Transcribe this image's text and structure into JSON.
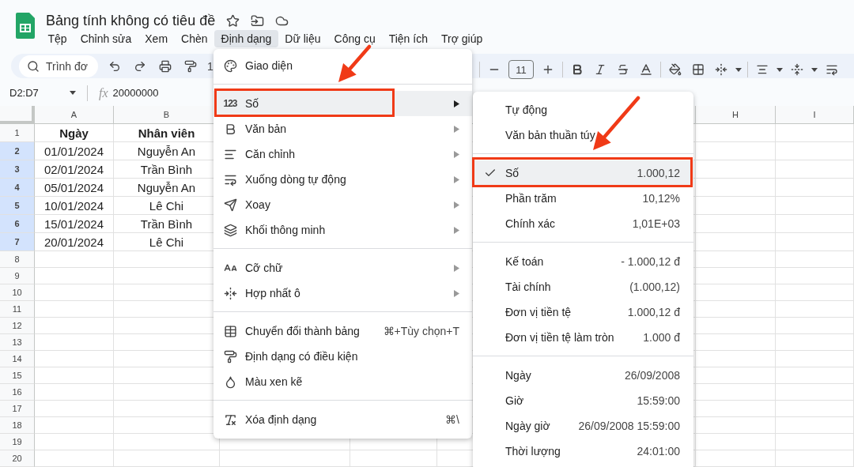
{
  "app": {
    "title": "Bảng tính không có tiêu đề",
    "menu": [
      {
        "label": "Tệp",
        "selected": false
      },
      {
        "label": "Chỉnh sửa",
        "selected": false
      },
      {
        "label": "Xem",
        "selected": false
      },
      {
        "label": "Chèn",
        "selected": false
      },
      {
        "label": "Định dạng",
        "selected": true
      },
      {
        "label": "Dữ liệu",
        "selected": false
      },
      {
        "label": "Công cụ",
        "selected": false
      },
      {
        "label": "Tiện ích",
        "selected": false
      },
      {
        "label": "Trợ giúp",
        "selected": false
      }
    ]
  },
  "toolbar": {
    "search_placeholder": "Trình đơ",
    "zoom": "1",
    "font_size": "11"
  },
  "formula_bar": {
    "range": "D2:D7",
    "fx_label": "fx",
    "formula": "20000000"
  },
  "sheet": {
    "columns_left": [
      "A",
      "B"
    ],
    "columns_right": [
      "H",
      "I"
    ],
    "rows": [
      {
        "number": "1",
        "selected": false,
        "kind": "header",
        "cells": [
          "Ngày",
          "Nhân viên"
        ]
      },
      {
        "number": "2",
        "selected": true,
        "kind": "data",
        "cells": [
          "01/01/2024",
          "Nguyễn An"
        ]
      },
      {
        "number": "3",
        "selected": true,
        "kind": "data",
        "cells": [
          "02/01/2024",
          "Trần Bình"
        ]
      },
      {
        "number": "4",
        "selected": true,
        "kind": "data",
        "cells": [
          "05/01/2024",
          "Nguyễn An"
        ]
      },
      {
        "number": "5",
        "selected": true,
        "kind": "data",
        "cells": [
          "10/01/2024",
          "Lê Chi"
        ]
      },
      {
        "number": "6",
        "selected": true,
        "kind": "data",
        "cells": [
          "15/01/2024",
          "Trần Bình"
        ]
      },
      {
        "number": "7",
        "selected": true,
        "kind": "data",
        "cells": [
          "20/01/2024",
          "Lê Chi"
        ]
      },
      {
        "number": "8",
        "selected": false,
        "kind": "data"
      },
      {
        "number": "9",
        "selected": false,
        "kind": "data"
      },
      {
        "number": "10",
        "selected": false,
        "kind": "data"
      },
      {
        "number": "11",
        "selected": false,
        "kind": "data"
      },
      {
        "number": "12",
        "selected": false,
        "kind": "data"
      },
      {
        "number": "13",
        "selected": false,
        "kind": "data"
      },
      {
        "number": "14",
        "selected": false,
        "kind": "data"
      },
      {
        "number": "15",
        "selected": false,
        "kind": "data"
      },
      {
        "number": "16",
        "selected": false,
        "kind": "data"
      },
      {
        "number": "17",
        "selected": false,
        "kind": "data"
      },
      {
        "number": "18",
        "selected": false,
        "kind": "data"
      },
      {
        "number": "19",
        "selected": false,
        "kind": "data"
      },
      {
        "number": "20",
        "selected": false,
        "kind": "data"
      }
    ]
  },
  "format_menu": {
    "groups": [
      [
        {
          "label": "Giao diện",
          "submenu": false,
          "selected": false
        }
      ],
      [
        {
          "glyph": "123",
          "label": "Số",
          "submenu": true,
          "selected": true
        },
        {
          "label": "Văn bản",
          "submenu": true,
          "selected": false
        },
        {
          "label": "Căn chỉnh",
          "submenu": true,
          "selected": false
        },
        {
          "label": "Xuống dòng tự động",
          "submenu": true,
          "selected": false
        },
        {
          "label": "Xoay",
          "submenu": true,
          "selected": false
        },
        {
          "label": "Khối thông minh",
          "submenu": true,
          "selected": false
        }
      ],
      [
        {
          "label": "Cỡ chữ",
          "submenu": true,
          "selected": false
        },
        {
          "label": "Hợp nhất ô",
          "submenu": true,
          "selected": false
        }
      ],
      [
        {
          "label": "Chuyển đổi thành bảng",
          "shortcut": "⌘+Tùy chọn+T",
          "submenu": false,
          "selected": false
        },
        {
          "label": "Định dạng có điều kiện",
          "submenu": false,
          "selected": false
        },
        {
          "label": "Màu xen kẽ",
          "submenu": false,
          "selected": false
        }
      ],
      [
        {
          "label": "Xóa định dạng",
          "shortcut": "⌘\\",
          "submenu": false,
          "selected": false
        }
      ]
    ]
  },
  "number_submenu": {
    "groups": [
      [
        {
          "label": "Tự động",
          "checked": false,
          "selected": false
        },
        {
          "label": "Văn bản thuần túy",
          "checked": false,
          "selected": false
        }
      ],
      [
        {
          "label": "Số",
          "sample": "1.000,12",
          "checked": true,
          "selected": true
        },
        {
          "label": "Phần trăm",
          "sample": "10,12%",
          "checked": false,
          "selected": false
        },
        {
          "label": "Chính xác",
          "sample": "1,01E+03",
          "checked": false,
          "selected": false
        }
      ],
      [
        {
          "label": "Kế toán",
          "sample": "- 1.000,12 đ",
          "checked": false,
          "selected": false
        },
        {
          "label": "Tài chính",
          "sample": "(1.000,12)",
          "checked": false,
          "selected": false
        },
        {
          "label": "Đơn vị tiền tệ",
          "sample": "1.000,12 đ",
          "checked": false,
          "selected": false
        },
        {
          "label": "Đơn vị tiền tệ làm tròn",
          "sample": "1.000 đ",
          "checked": false,
          "selected": false
        }
      ],
      [
        {
          "label": "Ngày",
          "sample": "26/09/2008",
          "checked": false,
          "selected": false
        },
        {
          "label": "Giờ",
          "sample": "15:59:00",
          "checked": false,
          "selected": false
        },
        {
          "label": "Ngày giờ",
          "sample": "26/09/2008 15:59:00",
          "checked": false,
          "selected": false
        },
        {
          "label": "Thời lượng",
          "sample": "24:01:00",
          "checked": false,
          "selected": false
        }
      ]
    ]
  }
}
